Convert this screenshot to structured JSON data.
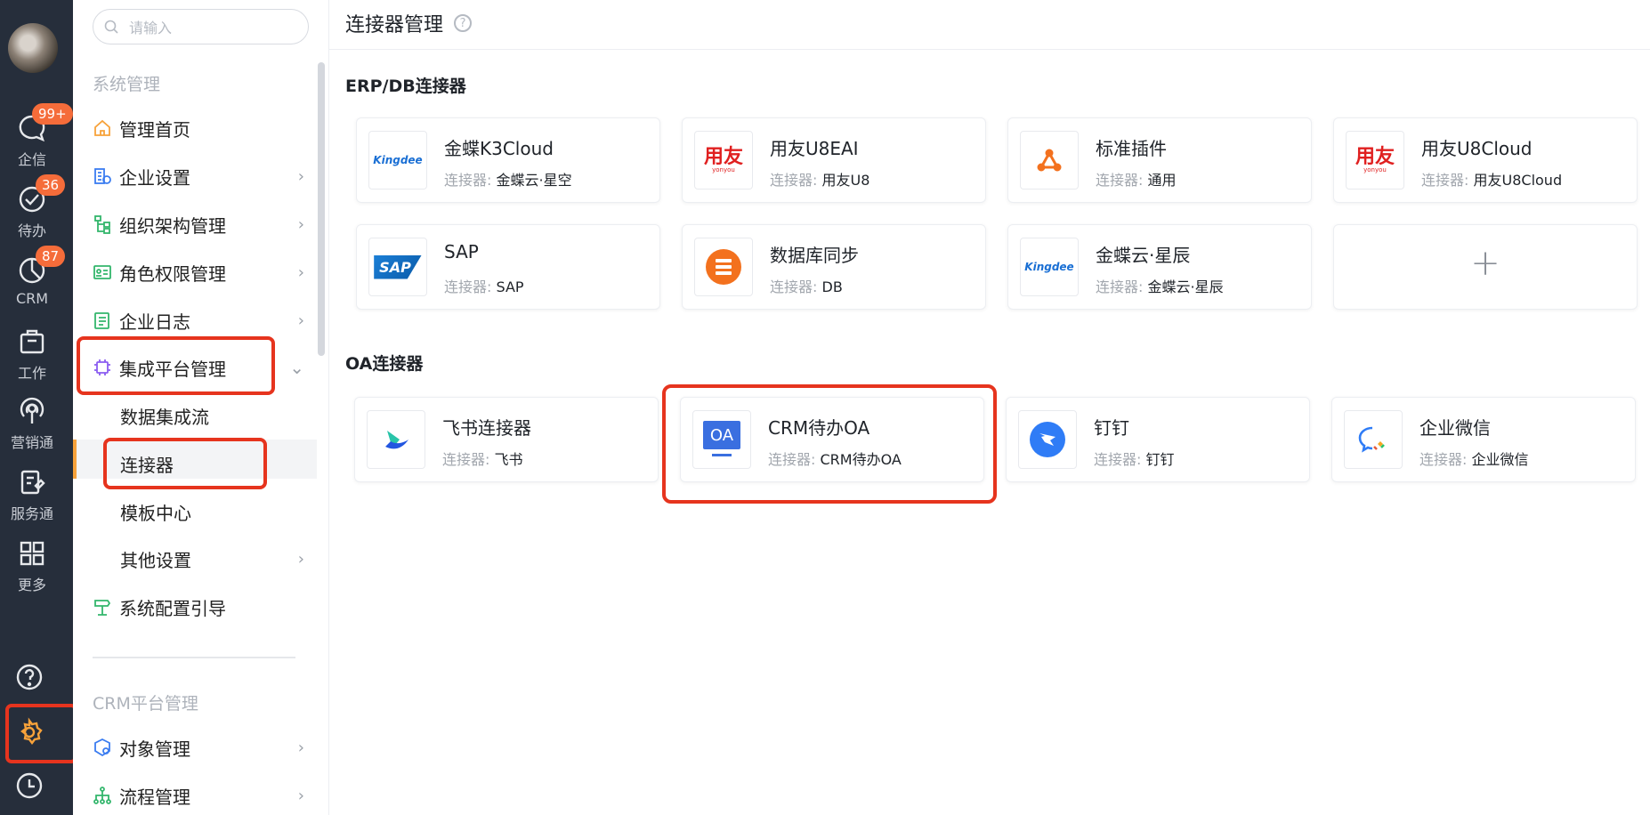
{
  "rail": {
    "items": [
      {
        "label": "企信",
        "icon": "chat-icon",
        "badge": "99+"
      },
      {
        "label": "待办",
        "icon": "check-circle-icon",
        "badge": "36"
      },
      {
        "label": "CRM",
        "icon": "pie-chart-icon",
        "badge": "87"
      },
      {
        "label": "工作",
        "icon": "briefcase-icon",
        "badge": ""
      },
      {
        "label": "营销通",
        "icon": "broadcast-icon",
        "badge": ""
      },
      {
        "label": "服务通",
        "icon": "service-icon",
        "badge": ""
      },
      {
        "label": "更多",
        "icon": "grid-icon",
        "badge": ""
      }
    ],
    "bottom": [
      "help-icon",
      "gear-icon",
      "clock-icon"
    ]
  },
  "sidebar": {
    "search_placeholder": "请输入",
    "group1": "系统管理",
    "menu": [
      {
        "label": "管理首页",
        "icon": "home-icon",
        "chevron": ""
      },
      {
        "label": "企业设置",
        "icon": "building-icon",
        "chevron": "›"
      },
      {
        "label": "组织架构管理",
        "icon": "org-tree-icon",
        "chevron": "›"
      },
      {
        "label": "角色权限管理",
        "icon": "id-card-icon",
        "chevron": "›"
      },
      {
        "label": "企业日志",
        "icon": "log-icon",
        "chevron": "›"
      },
      {
        "label": "集成平台管理",
        "icon": "chip-icon",
        "chevron": "⌄"
      }
    ],
    "submenu": [
      "数据集成流",
      "连接器",
      "模板中心",
      "其他设置"
    ],
    "other_settings_chevron": "›",
    "guide": "系统配置引导",
    "group2": "CRM平台管理",
    "menu2": [
      {
        "label": "对象管理",
        "icon": "object-icon",
        "chevron": "›"
      },
      {
        "label": "流程管理",
        "icon": "flow-icon",
        "chevron": "›"
      }
    ]
  },
  "main": {
    "title": "连接器管理",
    "help": "?",
    "section1": "ERP/DB连接器",
    "section2": "OA连接器",
    "meta_key": "连接器:",
    "erp_cards": [
      {
        "name": "金蝶K3Cloud",
        "type": "金蝶云·星空",
        "logo": "kingdee-logo"
      },
      {
        "name": "用友U8EAI",
        "type": "用友U8",
        "logo": "yonyou-logo"
      },
      {
        "name": "标准插件",
        "type": "通用",
        "logo": "plugin-logo"
      },
      {
        "name": "用友U8Cloud",
        "type": "用友U8Cloud",
        "logo": "yonyou-logo"
      },
      {
        "name": "SAP",
        "type": "SAP",
        "logo": "sap-logo"
      },
      {
        "name": "数据库同步",
        "type": "DB",
        "logo": "database-logo"
      },
      {
        "name": "金蝶云·星辰",
        "type": "金蝶云·星辰",
        "logo": "kingdee-logo"
      }
    ],
    "add_label": "+",
    "oa_cards": [
      {
        "name": "飞书连接器",
        "type": "飞书",
        "logo": "feishu-logo"
      },
      {
        "name": "CRM待办OA",
        "type": "CRM待办OA",
        "logo": "oa-logo"
      },
      {
        "name": "钉钉",
        "type": "钉钉",
        "logo": "dingtalk-logo"
      },
      {
        "name": "企业微信",
        "type": "企业微信",
        "logo": "wecom-logo"
      }
    ],
    "logo_text": {
      "kingdee": "Kingdee",
      "yonyou": "用友",
      "yonyou_sub": "yonyou",
      "sap": "SAP",
      "oa": "OA"
    }
  },
  "colors": {
    "accent": "#f7a23a",
    "highlight": "#e6341e",
    "rail": "#262e3b",
    "badge": "#f56c3a"
  }
}
